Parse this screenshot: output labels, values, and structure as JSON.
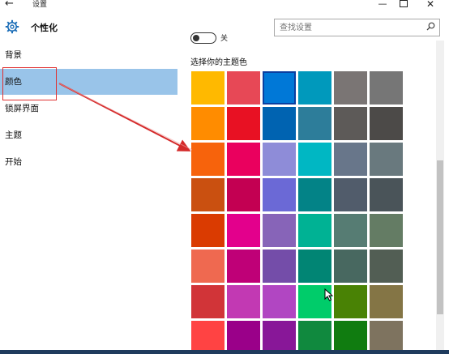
{
  "window": {
    "back_glyph": "←",
    "title": "设置",
    "minimize_glyph": "—",
    "close_glyph": "✕"
  },
  "header": {
    "icon": "gear-icon",
    "section_title": "个性化"
  },
  "search": {
    "placeholder": "查找设置",
    "icon": "search-icon"
  },
  "sidebar": {
    "items": [
      {
        "label": "背景",
        "selected": false
      },
      {
        "label": "颜色",
        "selected": true
      },
      {
        "label": "锁屏界面",
        "selected": false
      },
      {
        "label": "主题",
        "selected": false
      },
      {
        "label": "开始",
        "selected": false
      }
    ]
  },
  "content": {
    "toggle_label": "关",
    "swatch_heading": "选择你的主题色",
    "swatches": [
      [
        "#FFB900",
        "#E74856",
        "#0078D7",
        "#0099BC",
        "#7A7574",
        "#767676"
      ],
      [
        "#FF8C00",
        "#E81123",
        "#0063B1",
        "#2D7D9A",
        "#5D5A58",
        "#4C4A48"
      ],
      [
        "#F7630C",
        "#EA005E",
        "#8E8CD8",
        "#00B7C3",
        "#68768A",
        "#69797E"
      ],
      [
        "#CA5010",
        "#C30052",
        "#6B69D6",
        "#038387",
        "#515C6B",
        "#4A5459"
      ],
      [
        "#DA3B01",
        "#E3008C",
        "#8764B8",
        "#00B294",
        "#567C73",
        "#647C64"
      ],
      [
        "#EF6950",
        "#BF0077",
        "#744DA9",
        "#018574",
        "#486860",
        "#525E54"
      ],
      [
        "#D13438",
        "#C239B3",
        "#B146C2",
        "#00CC6A",
        "#498205",
        "#847545"
      ],
      [
        "#FF4343",
        "#9A0089",
        "#881798",
        "#10893E",
        "#107C10",
        "#7E735F"
      ]
    ],
    "selected_swatch_color": "#0078D7"
  },
  "colors": {
    "accent": "#99c4e9",
    "annotation_red": "#e03030",
    "taskbar": "#1f3b5d"
  }
}
